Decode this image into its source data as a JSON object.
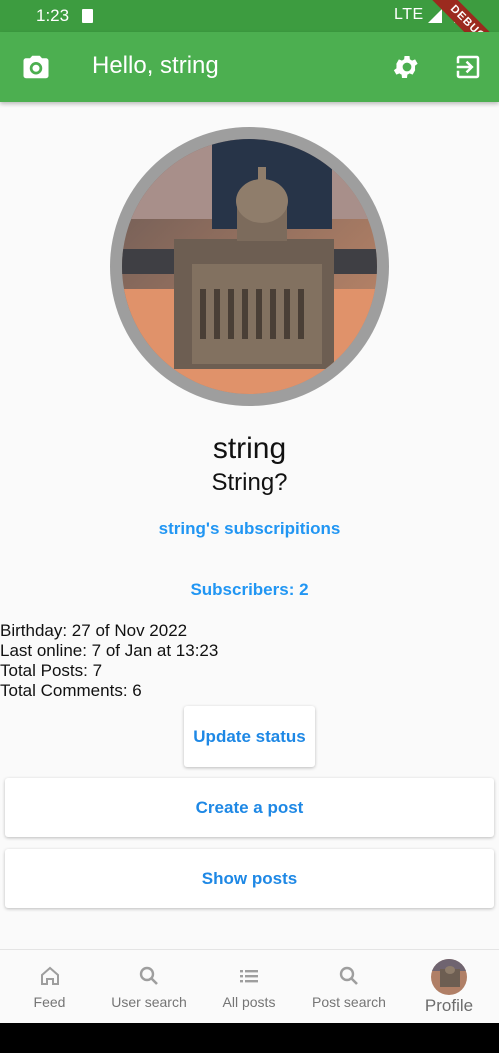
{
  "status_bar": {
    "time": "1:23",
    "network": "LTE",
    "debug_banner": "DEBUG"
  },
  "app_bar": {
    "title": "Hello, string",
    "camera_icon": "camera-icon",
    "settings_icon": "gear-icon",
    "logout_icon": "logout-icon",
    "color": "#4caf50"
  },
  "profile": {
    "name": "string",
    "status": "String?",
    "subscriptions_link": "string's subscripitions",
    "subscribers_link": "Subscribers: 2",
    "birthday": "Birthday: 27 of Nov 2022",
    "last_online": "Last online: 7 of Jan at 13:23",
    "total_posts": "Total Posts: 7",
    "total_comments": "Total Comments: 6"
  },
  "actions": {
    "update_status": "Update status",
    "create_post": "Create a post",
    "show_posts": "Show posts"
  },
  "bottom_nav": {
    "items": [
      {
        "label": "Feed",
        "icon": "home-icon"
      },
      {
        "label": "User search",
        "icon": "search-icon"
      },
      {
        "label": "All posts",
        "icon": "list-icon"
      },
      {
        "label": "Post search",
        "icon": "search-icon"
      },
      {
        "label": "Profile",
        "icon": "avatar"
      }
    ],
    "selected": "Profile"
  },
  "colors": {
    "accent_link": "#2196f3",
    "avatar_ring": "#9e9e9e"
  }
}
